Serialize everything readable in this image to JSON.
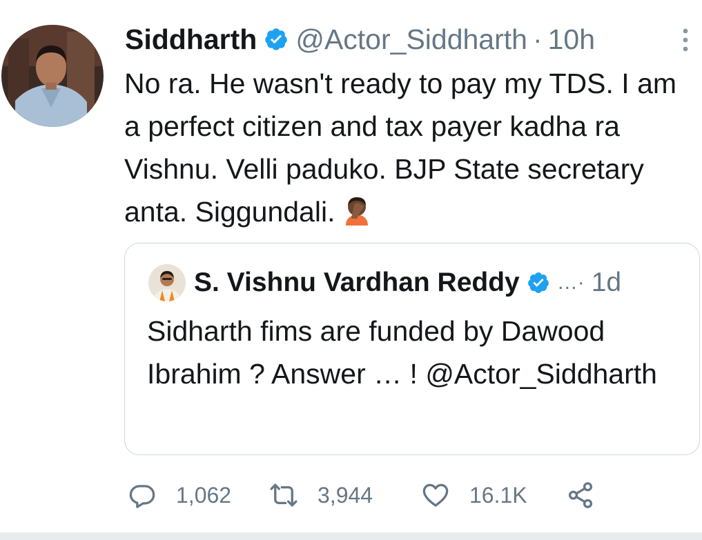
{
  "tweet": {
    "display_name": "Siddharth",
    "handle": "@Actor_Siddharth",
    "separator": "·",
    "time": "10h",
    "text": "No ra. He wasn't ready to pay my TDS. I am a perfect citizen and tax payer kadha ra Vishnu. Velli paduko. BJP State secretary anta. Siggundali.",
    "emoji": "face-palm-emoji"
  },
  "quote": {
    "display_name": "S. Vishnu Vardhan Reddy",
    "ellipsis": "…·",
    "time": "1d",
    "text": "Sidharth fims are funded by Dawood Ibrahim ? Answer … ! @Actor_Siddharth"
  },
  "actions": {
    "reply_count": "1,062",
    "retweet_count": "3,944",
    "like_count": "16.1K"
  },
  "colors": {
    "text": "#14171a",
    "muted": "#657786",
    "verified": "#1da1f2",
    "border": "#ccd6dd"
  }
}
